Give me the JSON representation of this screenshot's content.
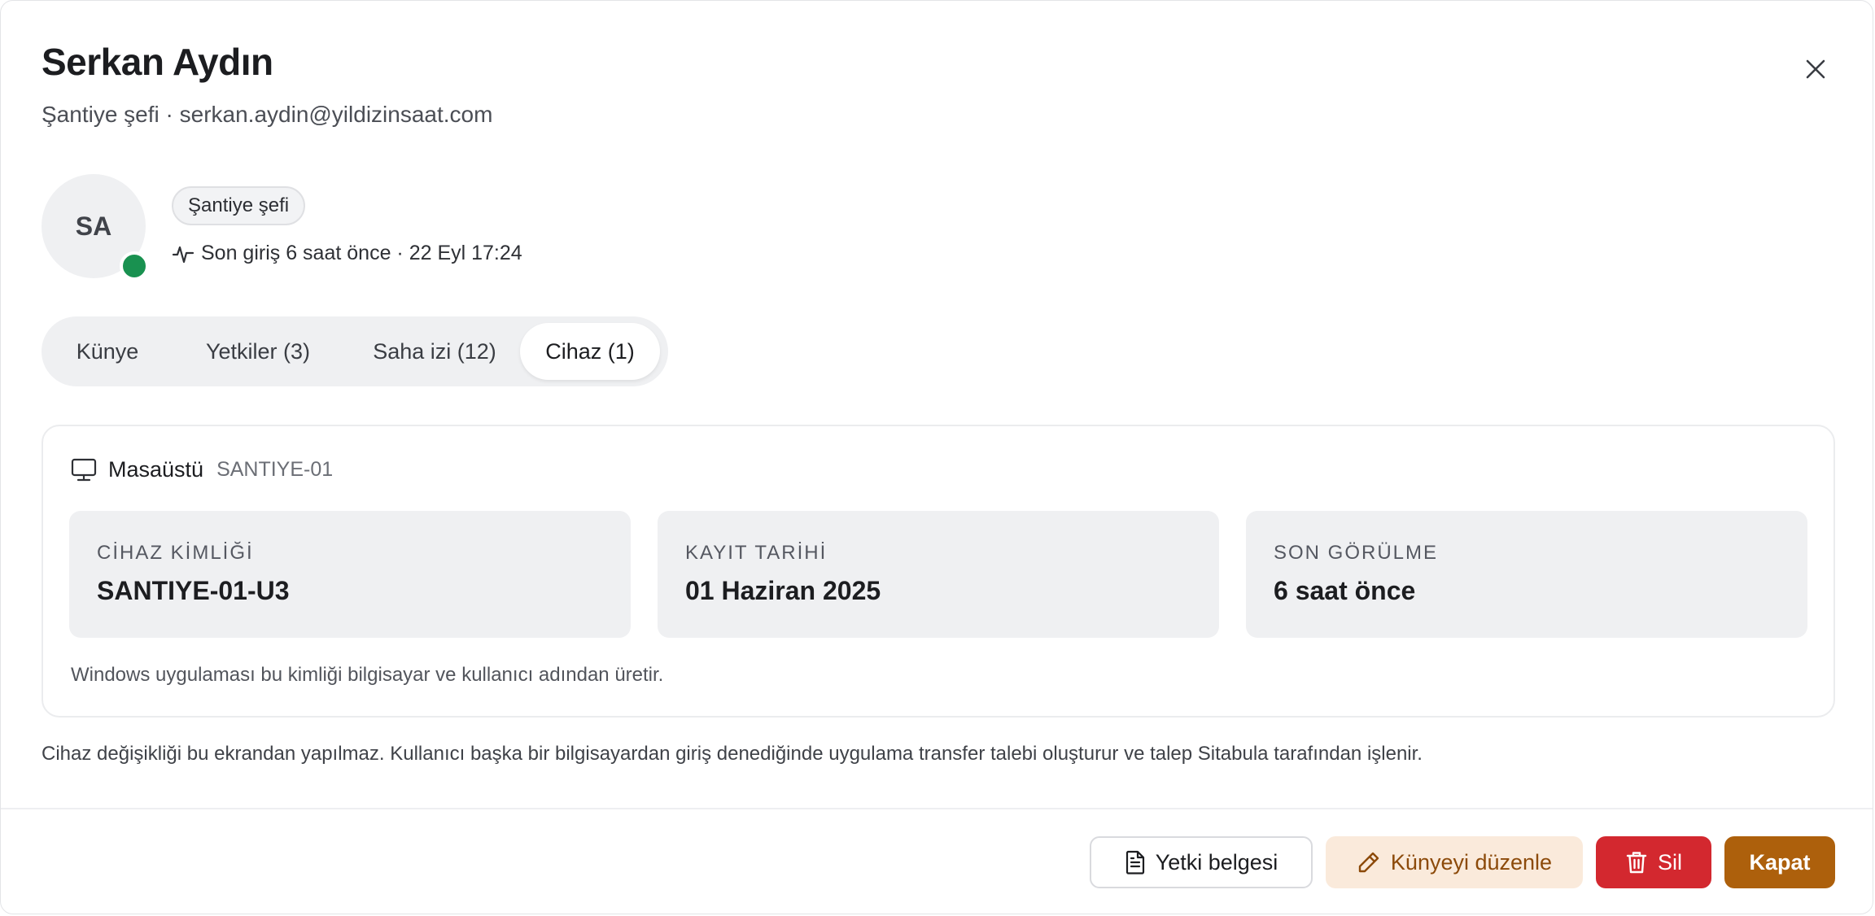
{
  "header": {
    "title": "Serkan Aydın",
    "subtitle": "Şantiye şefi · serkan.aydin@yildizinsaat.com",
    "close_icon": "close-icon"
  },
  "profile": {
    "initials": "SA",
    "status": "online",
    "status_color": "#199150",
    "role_chip": "Şantiye şefi",
    "last_login": "Son giriş 6 saat önce · 22 Eyl 17:24",
    "activity_icon": "activity-icon"
  },
  "tabs": [
    {
      "label": "Künye",
      "active": false
    },
    {
      "label": "Yetkiler (3)",
      "active": false
    },
    {
      "label": "Saha izi (12)",
      "active": false
    },
    {
      "label": "Cihaz (1)",
      "active": true
    }
  ],
  "device": {
    "icon": "monitor-icon",
    "type": "Masaüstü",
    "code": "SANTIYE-01",
    "fields": [
      {
        "label": "CİHAZ KİMLİĞİ",
        "value": "SANTIYE-01-U3"
      },
      {
        "label": "KAYIT TARİHİ",
        "value": "01 Haziran 2025"
      },
      {
        "label": "SON GÖRÜLME",
        "value": "6 saat önce"
      }
    ],
    "note": "Windows uygulaması bu kimliği bilgisayar ve kullanıcı adından üretir."
  },
  "info_note": "Cihaz değişikliği bu ekrandan yapılmaz. Kullanıcı başka bir bilgisayardan giriş denediğinde uygulama transfer talebi oluşturur ve talep Sitabula tarafından işlenir.",
  "footer": {
    "authority_doc_label": "Yetki belgesi",
    "edit_label": "Künyeyi düzenle",
    "delete_label": "Sil",
    "close_label": "Kapat"
  },
  "colors": {
    "accent": "#ad600c",
    "danger": "#d3282f",
    "edit_bg": "#faeadb",
    "edit_text": "#8c4a0a"
  }
}
